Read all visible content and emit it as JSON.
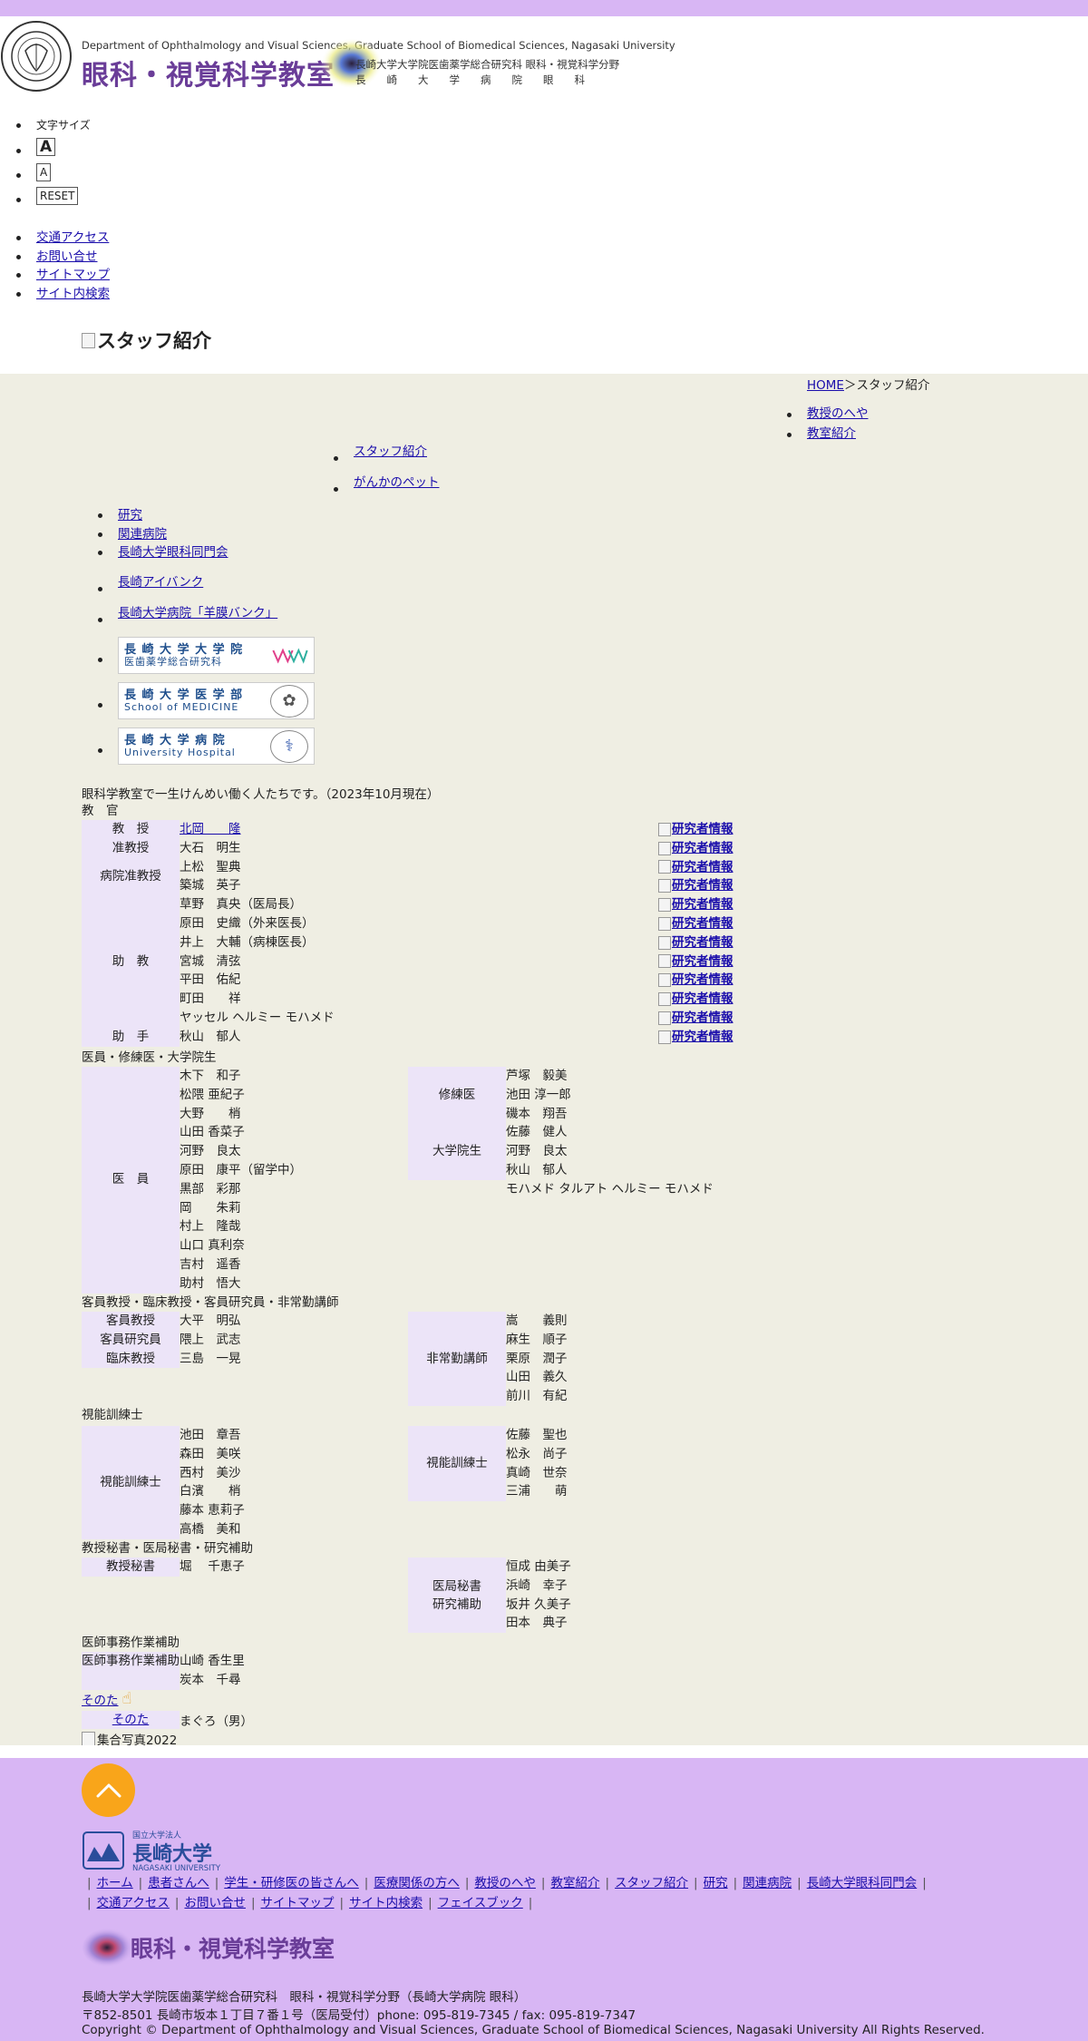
{
  "header": {
    "dept_en": "Department of Ophthalmology and Visual Sciences, Graduate School of Biomedical Sciences, Nagasaki University",
    "logo_jp": "眼科・視覚科学教室",
    "sub1": "長崎大学大学院医歯薬学総合研究科 眼科・視覚科学分野",
    "sub2": "長崎大学病院眼科",
    "seal_text": "UNIVERSITY SCHOOL 1857"
  },
  "font_size": {
    "label": "文字サイズ",
    "large": "A",
    "small": "A",
    "reset": "RESET"
  },
  "util_nav": [
    "交通アクセス",
    "お問い合せ",
    "サイトマップ",
    "サイト内検索"
  ],
  "page_title": "スタッフ紹介",
  "breadcrumb": {
    "home": "HOME",
    "sep": "＞",
    "current": "スタッフ紹介"
  },
  "side_nav": [
    "教授のへや",
    "教室紹介"
  ],
  "sub_nav": [
    "スタッフ紹介",
    "がんかのペット"
  ],
  "cat_nav": [
    "研究",
    "関連病院",
    "長崎大学眼科同門会"
  ],
  "ext_nav": [
    "長崎アイバンク",
    "長崎大学病院「羊膜バンク」"
  ],
  "banners": [
    {
      "line1": "長 崎 大 学 大 学 院",
      "line2": "医歯薬学総合研究科"
    },
    {
      "line1": "長 崎 大 学 医 学 部",
      "line2": "School of MEDICINE"
    },
    {
      "line1": "長 崎 大 学 病 院",
      "line2": "University Hospital"
    }
  ],
  "intro": "眼科学教室で一生けんめい働く人たちです。（2023年10月現在）",
  "research_info_label": "研究者情報",
  "faculty": {
    "title": "教　官",
    "rows": [
      {
        "role": "教　授",
        "name": "北岡　　隆",
        "link": true
      },
      {
        "role": "准教授",
        "name": "大石　明生"
      },
      {
        "role": "病院准教授",
        "name": "上松　聖典"
      },
      {
        "role": "",
        "name": "築城　英子"
      },
      {
        "role": "助　教",
        "name": "草野　真央（医局長）"
      },
      {
        "role": "",
        "name": "原田　史織（外来医長）"
      },
      {
        "role": "",
        "name": "井上　大輔（病棟医長）"
      },
      {
        "role": "",
        "name": "宮城　清弦"
      },
      {
        "role": "",
        "name": "平田　佑紀"
      },
      {
        "role": "",
        "name": "町田　　祥"
      },
      {
        "role": "",
        "name": "ヤッセル ヘルミー モハメド"
      },
      {
        "role": "助　手",
        "name": "秋山　郁人"
      }
    ]
  },
  "medical": {
    "title": "医員・修練医・大学院生",
    "doctor_role": "医　員",
    "doctors": [
      "木下　和子",
      "松隈 亜紀子",
      "大野　　梢",
      "山田 香菜子",
      "河野　良太",
      "原田　康平（留学中）",
      "黒部　彩那",
      "岡　　朱莉",
      "村上　隆哉",
      "山口 真利奈",
      "吉村　遥香",
      "助村　悟大"
    ],
    "trainee_role": "修練医",
    "trainees": [
      "芦塚　毅美",
      "池田 淳一郎",
      "磯本　翔吾"
    ],
    "grad_role": "大学院生",
    "grads": [
      "佐藤　健人",
      "河野　良太",
      "秋山　郁人",
      "モハメド タルアト ヘルミー モハメド"
    ]
  },
  "guest": {
    "title": "客員教授・臨床教授・客員研究員・非常勤講師",
    "rows": [
      {
        "role": "客員教授",
        "name": "大平　明弘"
      },
      {
        "role": "客員研究員",
        "name": "隈上　武志"
      },
      {
        "role": "臨床教授",
        "name": "三島　一晃"
      }
    ],
    "lecturer_role": "非常勤講師",
    "lecturers": [
      "嵩　　義則",
      "麻生　順子",
      "栗原　潤子",
      "山田　義久",
      "前川　有紀"
    ]
  },
  "orthoptist": {
    "title": "視能訓練士",
    "role": "視能訓練士",
    "left": [
      "池田　章吾",
      "森田　美咲",
      "西村　美沙",
      "白濱　　梢",
      "藤本 恵莉子",
      "高橋　美和"
    ],
    "right": [
      "佐藤　聖也",
      "松永　尚子",
      "真崎　世奈",
      "三浦　　萌"
    ]
  },
  "secretary": {
    "title": "教授秘書・医局秘書・研究補助",
    "prof_role": "教授秘書",
    "prof": [
      "堀　 千恵子"
    ],
    "office_role": "医局秘書",
    "research_role": "研究補助",
    "office": [
      "恒成 由美子",
      "浜崎　幸子",
      "坂井 久美子",
      "田本　典子"
    ]
  },
  "clerk": {
    "title": "医師事務作業補助",
    "role": "医師事務作業補助",
    "names": [
      "山崎 香生里",
      "炭本　千尋"
    ]
  },
  "other": {
    "link": "そのた",
    "role": "そのた",
    "text": "まぐろ（男）"
  },
  "group_photo_alt": "集合写真2022",
  "footer": {
    "nu_logo_top": "国立大学法人",
    "nu_logo_main": "長崎大学",
    "nu_logo_en": "NAGASAKI UNIVERSITY",
    "nav1": [
      "ホーム",
      "患者さんへ",
      "学生・研修医の皆さんへ",
      "医療関係の方へ",
      "教授のへや",
      "教室紹介",
      "スタッフ紹介",
      "研究",
      "関連病院",
      "長崎大学眼科同門会"
    ],
    "nav2": [
      "交通アクセス",
      "お問い合せ",
      "サイトマップ",
      "サイト内検索",
      "フェイスブック"
    ],
    "logo_text": "眼科・視覚科学教室",
    "addr1": "長崎大学大学院医歯薬学総合研究科　眼科・視覚科学分野（長崎大学病院 眼科）",
    "addr2": "〒852-8501 長崎市坂本１丁目７番１号（医局受付）phone: 095-819-7345 / fax: 095-819-7347",
    "copyright": "Copyright © Department of Ophthalmology and Visual Sciences, Graduate School of Biomedical Sciences, Nagasaki University All Rights Reserved."
  },
  "colors": {
    "lavender": "#d8b6f4",
    "beige": "#efeee3",
    "role_cell": "#ece4f8",
    "pagetop": "#f9a51a",
    "brand_purple": "#6a3d98"
  }
}
